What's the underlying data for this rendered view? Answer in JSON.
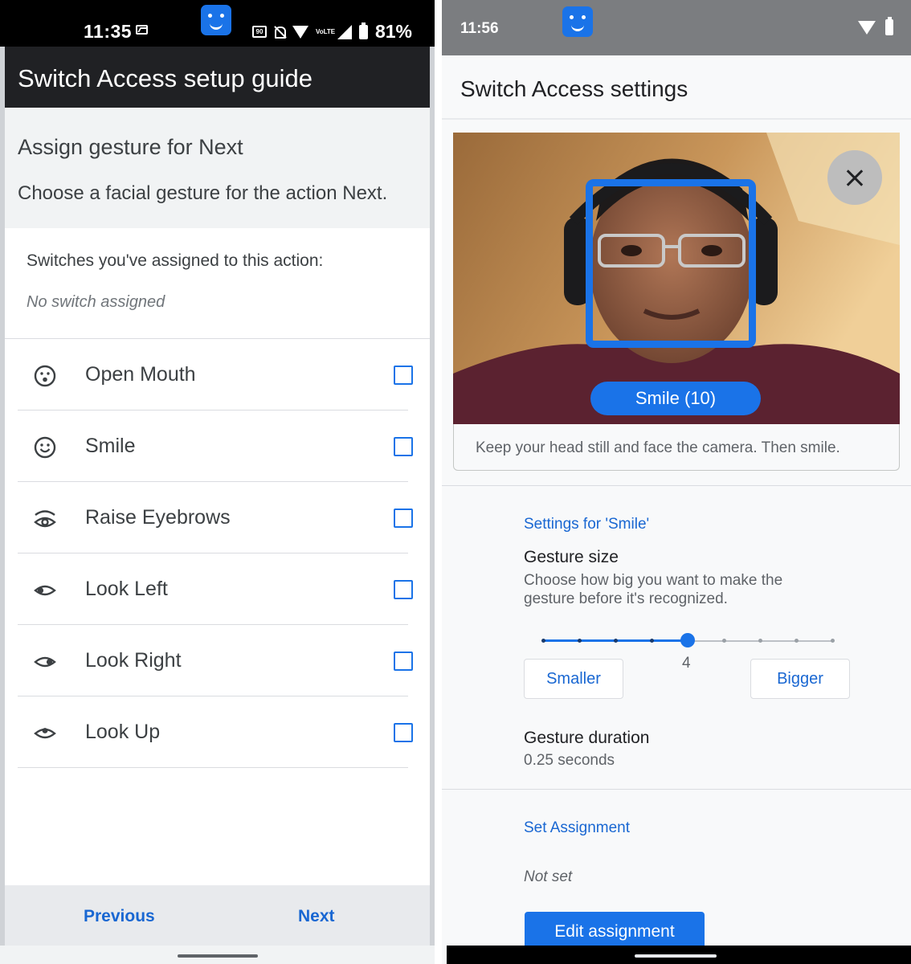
{
  "left": {
    "status_bar": {
      "time": "11:35",
      "battery": "81%",
      "icons": [
        "image-icon",
        "app-face-icon",
        "hd-icon",
        "bell-off-icon",
        "wifi-icon",
        "volte-icon",
        "signal-icon",
        "battery-icon"
      ],
      "volte_text": "VoLTE",
      "hd_text": "90"
    },
    "app_bar": {
      "title": "Switch Access setup guide"
    },
    "header": {
      "title": "Assign gesture for Next",
      "description": "Choose a facial gesture for the action Next."
    },
    "assigned": {
      "label": "Switches you've assigned to this action:",
      "value": "No switch assigned"
    },
    "gestures": [
      {
        "label": "Open Mouth",
        "icon": "open-mouth-face-icon",
        "checked": false
      },
      {
        "label": "Smile",
        "icon": "smile-face-icon",
        "checked": false
      },
      {
        "label": "Raise Eyebrows",
        "icon": "raise-eyebrows-eye-icon",
        "checked": false
      },
      {
        "label": "Look Left",
        "icon": "look-left-eye-icon",
        "checked": false
      },
      {
        "label": "Look Right",
        "icon": "look-right-eye-icon",
        "checked": false
      },
      {
        "label": "Look Up",
        "icon": "look-up-eye-icon",
        "checked": false
      }
    ],
    "footer": {
      "previous": "Previous",
      "next": "Next"
    }
  },
  "right": {
    "status_bar": {
      "time": "11:56",
      "icons": [
        "app-face-icon",
        "wifi-icon",
        "battery-charging-icon"
      ]
    },
    "app_bar": {
      "title": "Switch Access settings"
    },
    "camera": {
      "detected_gesture": "Smile (10)",
      "instruction": "Keep your head still and face the camera. Then smile."
    },
    "gesture_settings": {
      "section_title": "Settings for 'Smile'",
      "size_label": "Gesture size",
      "size_description": "Choose how big you want to make the gesture before it's recognized.",
      "size_value": "4",
      "slider": {
        "min": 0,
        "max": 8,
        "value": 4
      },
      "smaller": "Smaller",
      "bigger": "Bigger",
      "duration_label": "Gesture duration",
      "duration_value": "0.25 seconds"
    },
    "assignment": {
      "section_title": "Set Assignment",
      "value": "Not set",
      "edit_button": "Edit assignment"
    }
  },
  "colors": {
    "accent": "#1a73e8",
    "link": "#1967d2",
    "dark_appbar": "#202124"
  }
}
